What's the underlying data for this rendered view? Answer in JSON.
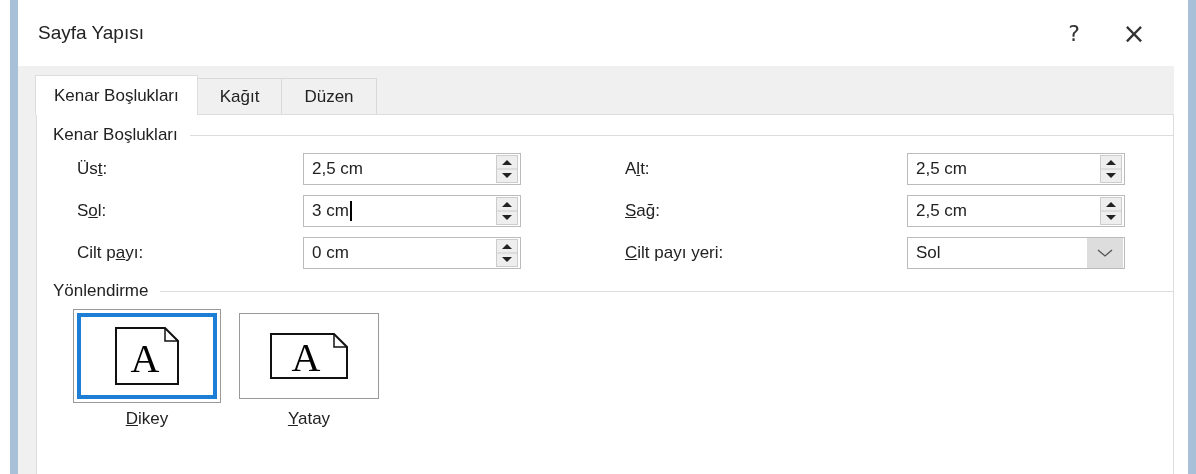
{
  "window": {
    "title": "Sayfa Yapısı",
    "help": "?",
    "close": "×"
  },
  "tabs": [
    {
      "label": "Kenar Boşlukları",
      "selected": true
    },
    {
      "label": "Kağıt",
      "selected": false
    },
    {
      "label": "Düzen",
      "selected": false
    }
  ],
  "margins": {
    "heading": "Kenar Boşlukları",
    "fields": [
      {
        "kind": "spin",
        "label": {
          "before": "Üs",
          "key": "t",
          "after": ":"
        },
        "value": "2,5 cm",
        "focused": false
      },
      {
        "kind": "spin",
        "label": {
          "before": "A",
          "key": "l",
          "after": "t:"
        },
        "value": "2,5 cm",
        "focused": false
      },
      {
        "kind": "spin",
        "label": {
          "before": "S",
          "key": "o",
          "after": "l:"
        },
        "value": "3 cm",
        "focused": true
      },
      {
        "kind": "spin",
        "label": {
          "key": "S",
          "after": "ağ:"
        },
        "value": "2,5 cm",
        "focused": false
      },
      {
        "kind": "spin",
        "label": {
          "before": "Cilt p",
          "key": "a",
          "after": "yı:"
        },
        "value": "0 cm",
        "focused": false
      },
      {
        "kind": "dropdown",
        "label": {
          "key": "C",
          "after": "ilt payı yeri:"
        },
        "value": "Sol",
        "focused": false
      }
    ]
  },
  "orientation": {
    "heading": "Yönlendirme",
    "options": [
      {
        "kind": "portrait",
        "icon_letter": "A",
        "label": {
          "key": "D",
          "after": "ikey"
        },
        "selected": true
      },
      {
        "kind": "landscape",
        "icon_letter": "A",
        "label": {
          "key": "Y",
          "after": "atay"
        },
        "selected": false
      }
    ]
  }
}
